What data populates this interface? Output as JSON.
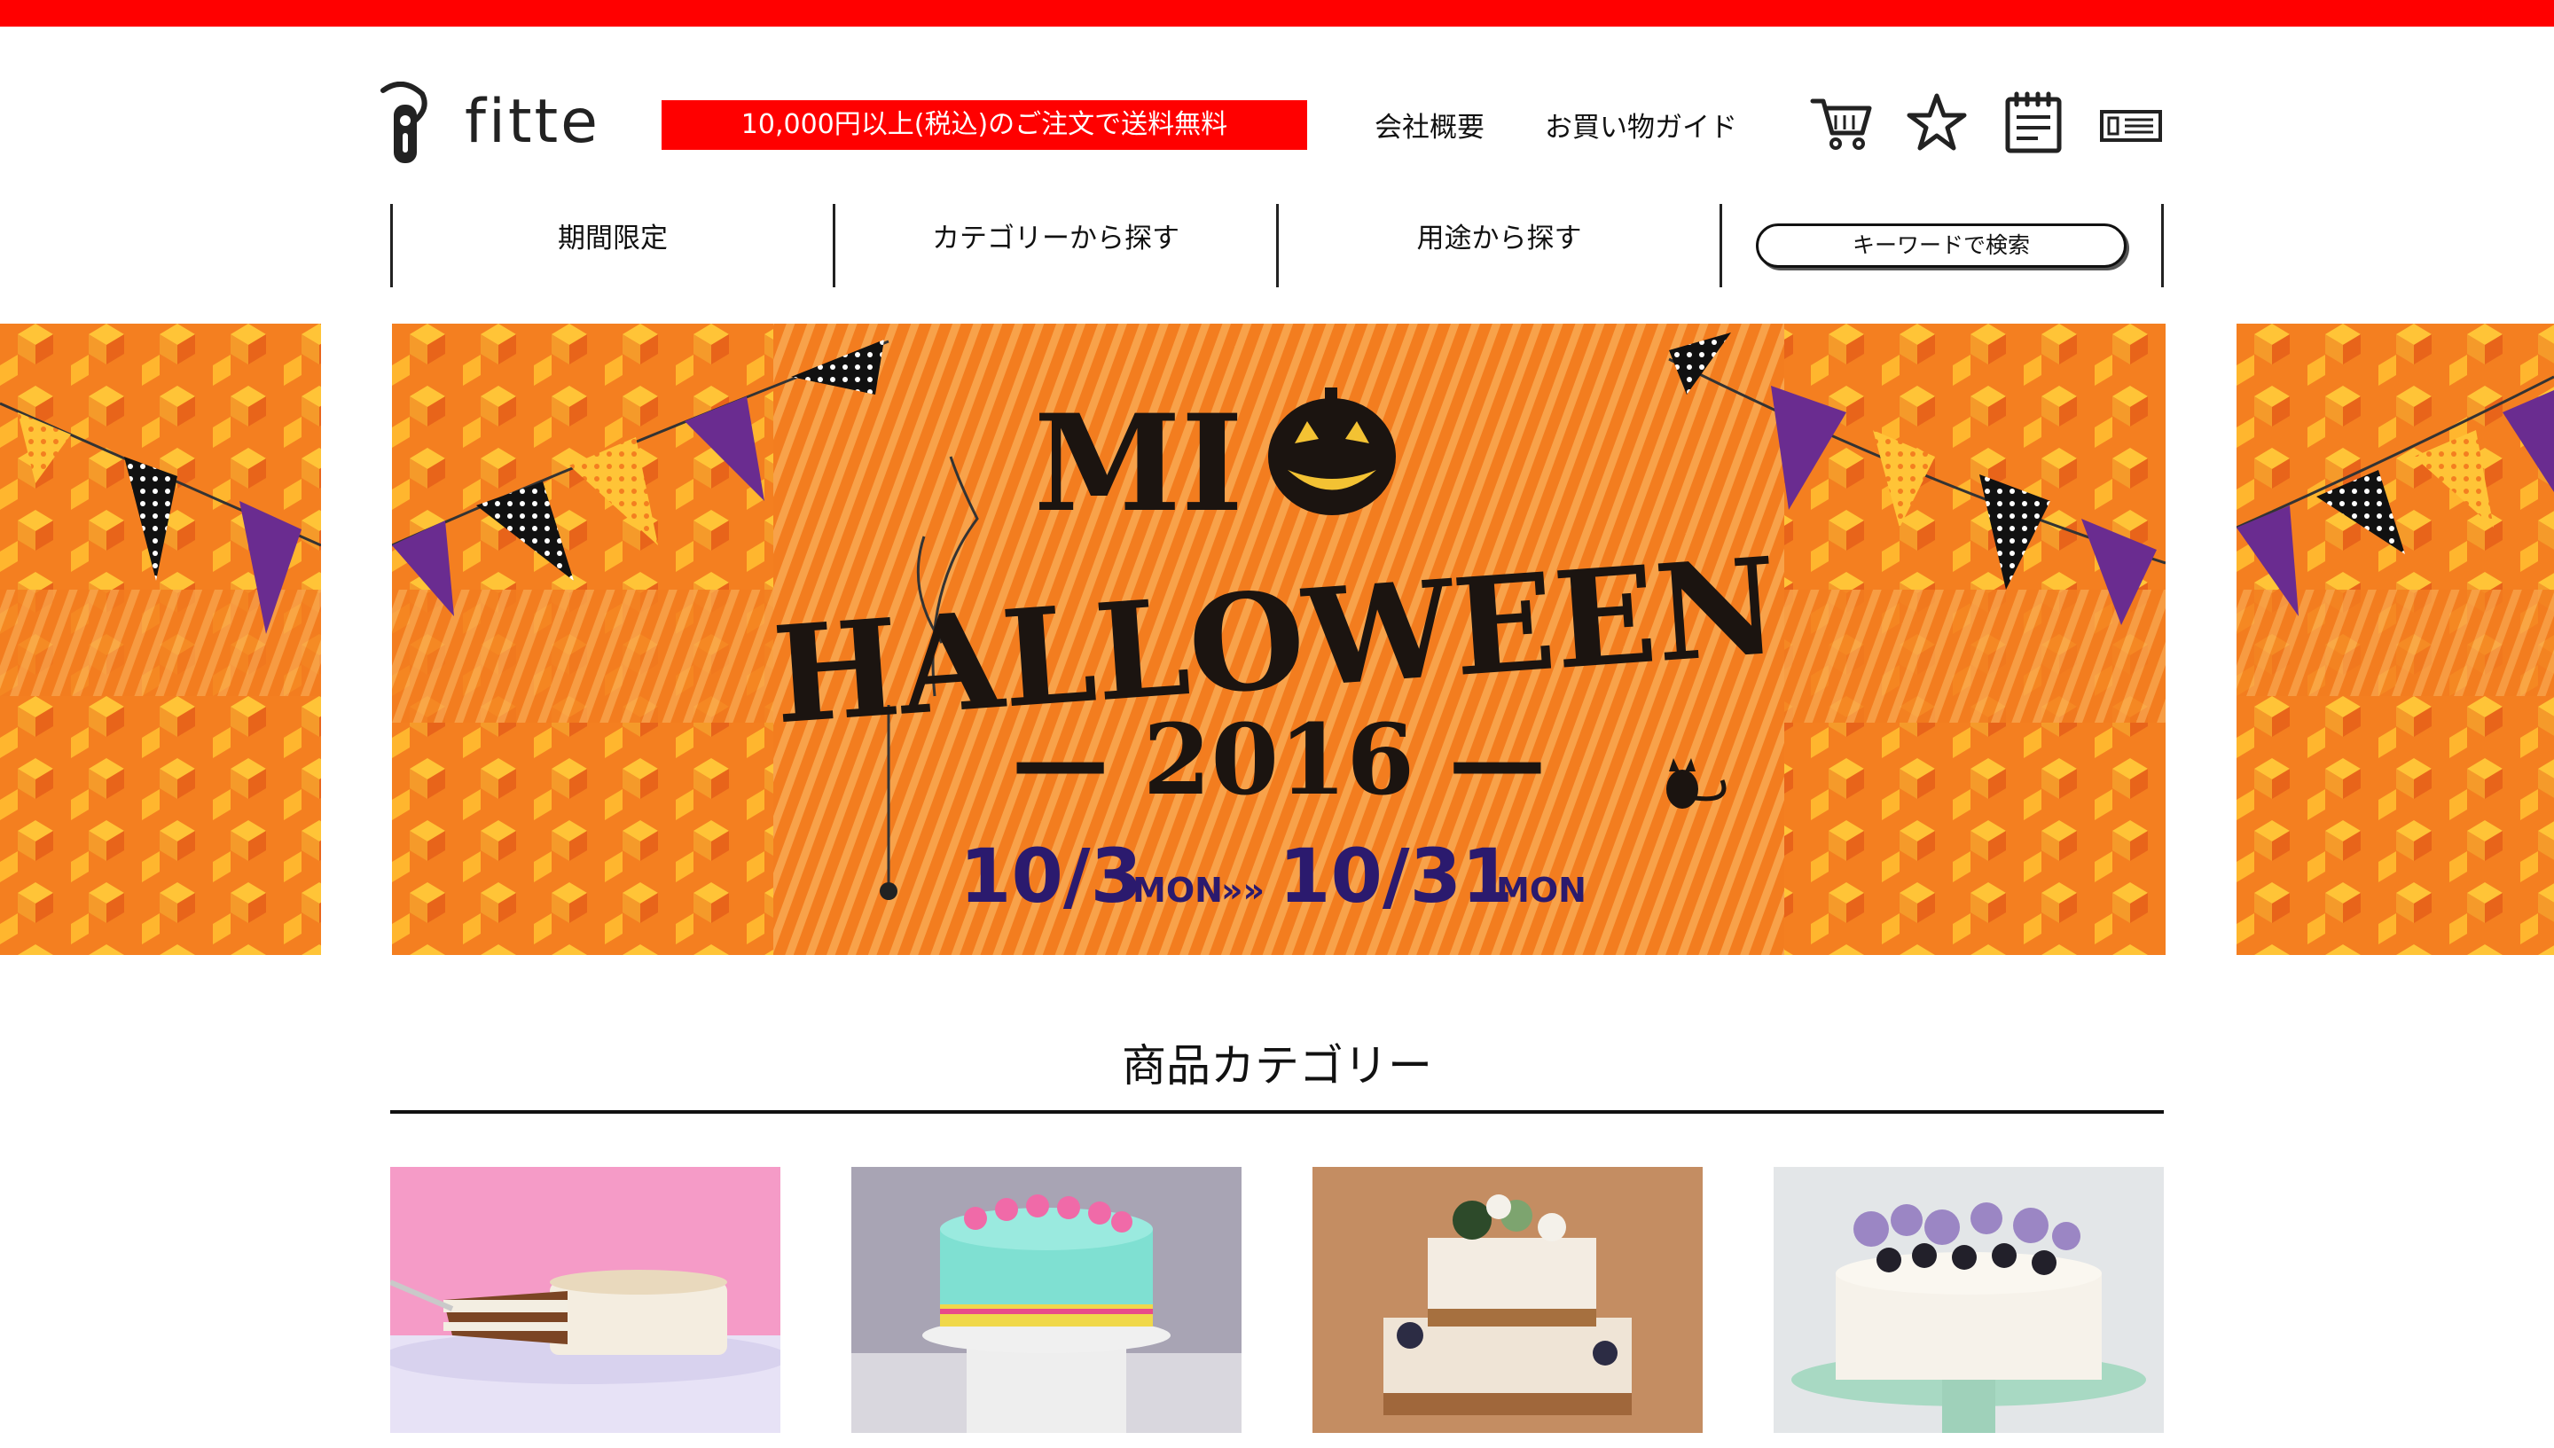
{
  "brand": {
    "name": "fitte"
  },
  "header": {
    "shipping_notice": "10,000円以上(税込)のご注文で送料無料",
    "links": [
      "会社概要",
      "お買い物ガイド"
    ],
    "icons": [
      "cart-icon",
      "favorite-star-icon",
      "notepad-icon",
      "id-card-icon"
    ]
  },
  "nav": {
    "items": [
      "期間限定",
      "カテゴリーから探す",
      "用途から探す"
    ],
    "search_label": "キーワードで検索"
  },
  "hero": {
    "line1": "MI",
    "line2": "HALLOWEEN",
    "year": "— 2016 —",
    "start_date": "10/3",
    "start_day": "MON",
    "arrow": "»»",
    "end_date": "10/31",
    "end_day": "MON"
  },
  "categories": {
    "title": "商品カテゴリー",
    "items": [
      "carrot-cake-slice",
      "mint-sprinkle-cake",
      "naked-flower-cake",
      "berry-flower-cake"
    ]
  },
  "colors": {
    "accent": "#ff0000",
    "banner_orange": "#f07a1e",
    "banner_yellow": "#ffc437",
    "banner_purple": "#6a2c90"
  }
}
